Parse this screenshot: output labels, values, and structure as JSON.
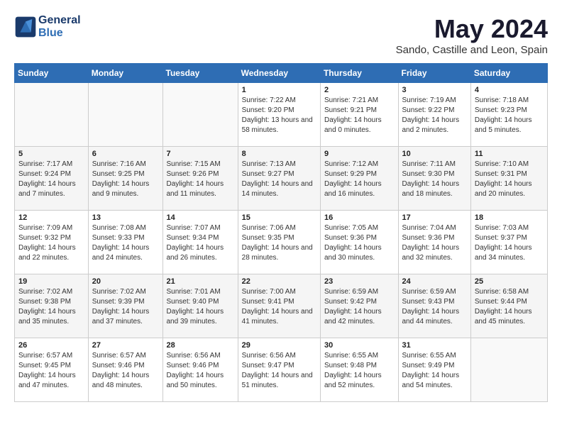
{
  "header": {
    "logo_line1": "General",
    "logo_line2": "Blue",
    "month_title": "May 2024",
    "location": "Sando, Castille and Leon, Spain"
  },
  "weekdays": [
    "Sunday",
    "Monday",
    "Tuesday",
    "Wednesday",
    "Thursday",
    "Friday",
    "Saturday"
  ],
  "weeks": [
    [
      {
        "day": "",
        "info": ""
      },
      {
        "day": "",
        "info": ""
      },
      {
        "day": "",
        "info": ""
      },
      {
        "day": "1",
        "info": "Sunrise: 7:22 AM\nSunset: 9:20 PM\nDaylight: 13 hours\nand 58 minutes."
      },
      {
        "day": "2",
        "info": "Sunrise: 7:21 AM\nSunset: 9:21 PM\nDaylight: 14 hours\nand 0 minutes."
      },
      {
        "day": "3",
        "info": "Sunrise: 7:19 AM\nSunset: 9:22 PM\nDaylight: 14 hours\nand 2 minutes."
      },
      {
        "day": "4",
        "info": "Sunrise: 7:18 AM\nSunset: 9:23 PM\nDaylight: 14 hours\nand 5 minutes."
      }
    ],
    [
      {
        "day": "5",
        "info": "Sunrise: 7:17 AM\nSunset: 9:24 PM\nDaylight: 14 hours\nand 7 minutes."
      },
      {
        "day": "6",
        "info": "Sunrise: 7:16 AM\nSunset: 9:25 PM\nDaylight: 14 hours\nand 9 minutes."
      },
      {
        "day": "7",
        "info": "Sunrise: 7:15 AM\nSunset: 9:26 PM\nDaylight: 14 hours\nand 11 minutes."
      },
      {
        "day": "8",
        "info": "Sunrise: 7:13 AM\nSunset: 9:27 PM\nDaylight: 14 hours\nand 14 minutes."
      },
      {
        "day": "9",
        "info": "Sunrise: 7:12 AM\nSunset: 9:29 PM\nDaylight: 14 hours\nand 16 minutes."
      },
      {
        "day": "10",
        "info": "Sunrise: 7:11 AM\nSunset: 9:30 PM\nDaylight: 14 hours\nand 18 minutes."
      },
      {
        "day": "11",
        "info": "Sunrise: 7:10 AM\nSunset: 9:31 PM\nDaylight: 14 hours\nand 20 minutes."
      }
    ],
    [
      {
        "day": "12",
        "info": "Sunrise: 7:09 AM\nSunset: 9:32 PM\nDaylight: 14 hours\nand 22 minutes."
      },
      {
        "day": "13",
        "info": "Sunrise: 7:08 AM\nSunset: 9:33 PM\nDaylight: 14 hours\nand 24 minutes."
      },
      {
        "day": "14",
        "info": "Sunrise: 7:07 AM\nSunset: 9:34 PM\nDaylight: 14 hours\nand 26 minutes."
      },
      {
        "day": "15",
        "info": "Sunrise: 7:06 AM\nSunset: 9:35 PM\nDaylight: 14 hours\nand 28 minutes."
      },
      {
        "day": "16",
        "info": "Sunrise: 7:05 AM\nSunset: 9:36 PM\nDaylight: 14 hours\nand 30 minutes."
      },
      {
        "day": "17",
        "info": "Sunrise: 7:04 AM\nSunset: 9:36 PM\nDaylight: 14 hours\nand 32 minutes."
      },
      {
        "day": "18",
        "info": "Sunrise: 7:03 AM\nSunset: 9:37 PM\nDaylight: 14 hours\nand 34 minutes."
      }
    ],
    [
      {
        "day": "19",
        "info": "Sunrise: 7:02 AM\nSunset: 9:38 PM\nDaylight: 14 hours\nand 35 minutes."
      },
      {
        "day": "20",
        "info": "Sunrise: 7:02 AM\nSunset: 9:39 PM\nDaylight: 14 hours\nand 37 minutes."
      },
      {
        "day": "21",
        "info": "Sunrise: 7:01 AM\nSunset: 9:40 PM\nDaylight: 14 hours\nand 39 minutes."
      },
      {
        "day": "22",
        "info": "Sunrise: 7:00 AM\nSunset: 9:41 PM\nDaylight: 14 hours\nand 41 minutes."
      },
      {
        "day": "23",
        "info": "Sunrise: 6:59 AM\nSunset: 9:42 PM\nDaylight: 14 hours\nand 42 minutes."
      },
      {
        "day": "24",
        "info": "Sunrise: 6:59 AM\nSunset: 9:43 PM\nDaylight: 14 hours\nand 44 minutes."
      },
      {
        "day": "25",
        "info": "Sunrise: 6:58 AM\nSunset: 9:44 PM\nDaylight: 14 hours\nand 45 minutes."
      }
    ],
    [
      {
        "day": "26",
        "info": "Sunrise: 6:57 AM\nSunset: 9:45 PM\nDaylight: 14 hours\nand 47 minutes."
      },
      {
        "day": "27",
        "info": "Sunrise: 6:57 AM\nSunset: 9:46 PM\nDaylight: 14 hours\nand 48 minutes."
      },
      {
        "day": "28",
        "info": "Sunrise: 6:56 AM\nSunset: 9:46 PM\nDaylight: 14 hours\nand 50 minutes."
      },
      {
        "day": "29",
        "info": "Sunrise: 6:56 AM\nSunset: 9:47 PM\nDaylight: 14 hours\nand 51 minutes."
      },
      {
        "day": "30",
        "info": "Sunrise: 6:55 AM\nSunset: 9:48 PM\nDaylight: 14 hours\nand 52 minutes."
      },
      {
        "day": "31",
        "info": "Sunrise: 6:55 AM\nSunset: 9:49 PM\nDaylight: 14 hours\nand 54 minutes."
      },
      {
        "day": "",
        "info": ""
      }
    ]
  ]
}
